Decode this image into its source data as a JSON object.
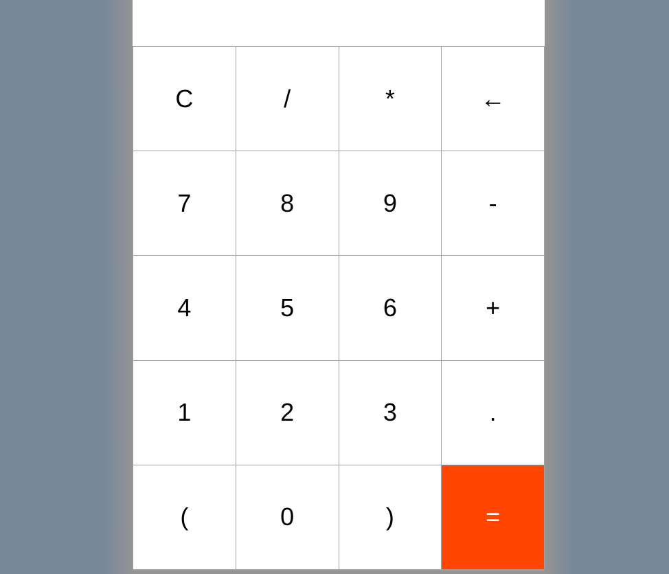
{
  "display": {
    "value": ""
  },
  "colors": {
    "page_background": "#778899",
    "key_background": "#ffffff",
    "key_border": "#a0a0a0",
    "equals_background": "#ff4500",
    "equals_text": "#ffffff"
  },
  "keys": {
    "clear": "C",
    "divide": "/",
    "multiply": "*",
    "backspace": "←",
    "seven": "7",
    "eight": "8",
    "nine": "9",
    "minus": "-",
    "four": "4",
    "five": "5",
    "six": "6",
    "plus": "+",
    "one": "1",
    "two": "2",
    "three": "3",
    "decimal": ".",
    "open_paren": "(",
    "zero": "0",
    "close_paren": ")",
    "equals": "="
  }
}
